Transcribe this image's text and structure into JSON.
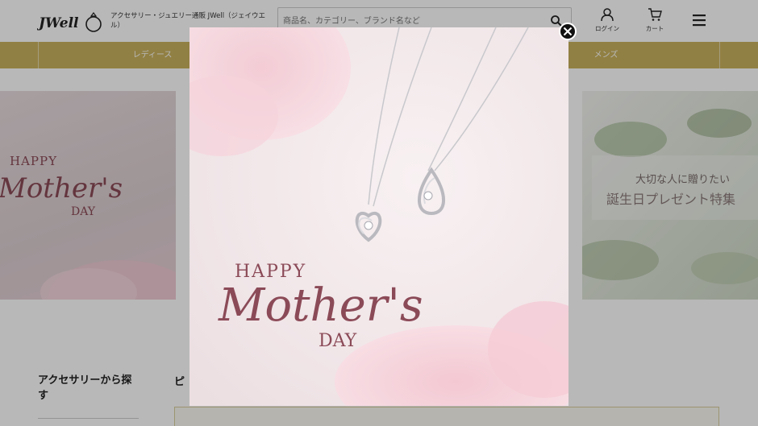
{
  "header": {
    "logo_text": "JWell",
    "tagline": "アクセサリー・ジュエリー通販 JWell（ジェイウエル）",
    "search_placeholder": "商品名、カテゴリー、ブランド名など",
    "login_label": "ログイン",
    "cart_label": "カート"
  },
  "nav": {
    "items": [
      "レディース",
      "メンズ"
    ]
  },
  "main": {
    "banner_left": {
      "line1": "HAPPY",
      "line2": "Mother's",
      "line3": "DAY"
    },
    "banner_right": {
      "line1": "大切な人に贈りたい",
      "line2": "誕生日プレゼント特集"
    },
    "side_title": "アクセサリーから探す",
    "pick_title": "ピ"
  },
  "modal": {
    "line1": "HAPPY",
    "line2": "Mother's",
    "line3": "DAY"
  },
  "colors": {
    "gold": "#c9b25e",
    "rose_text": "#8b4a57",
    "overlay": "rgba(0,0,0,0.28)"
  }
}
